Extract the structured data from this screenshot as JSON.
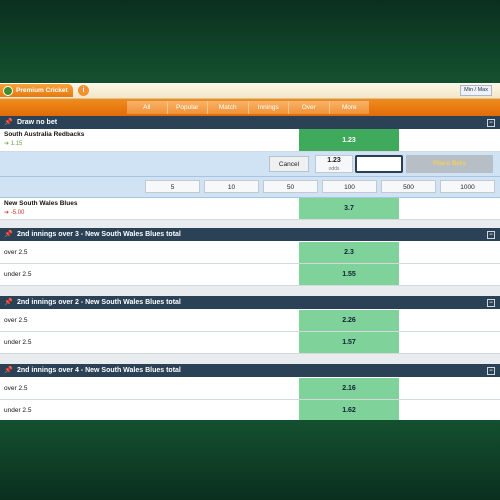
{
  "topbar": {
    "app_title": "Premium Cricket",
    "info_label": "i",
    "minmax_label": "Min / Max"
  },
  "filters": [
    "All",
    "Popular",
    "Match",
    "Innings",
    "Over",
    "More"
  ],
  "draw_no_bet": {
    "title": "Draw no bet",
    "selection1": {
      "name": "South Australia Redbacks",
      "change": "1.15",
      "odds": "1.23"
    },
    "betslip": {
      "cancel_label": "Cancel",
      "odds_value": "1.23",
      "odds_caption": "odds",
      "stake_value": "",
      "place_bet_label": "Place Bets",
      "quick_stakes": [
        "5",
        "10",
        "50",
        "100",
        "500",
        "1000"
      ]
    },
    "selection2": {
      "name": "New South Wales Blues",
      "change": "-5.00",
      "odds": "3.7"
    }
  },
  "markets": [
    {
      "title": "2nd innings over 3 - New South Wales Blues total",
      "rows": [
        {
          "label": "over 2.5",
          "odds": "2.3"
        },
        {
          "label": "under 2.5",
          "odds": "1.55"
        }
      ]
    },
    {
      "title": "2nd innings over 2 - New South Wales Blues total",
      "rows": [
        {
          "label": "over 2.5",
          "odds": "2.26"
        },
        {
          "label": "under 2.5",
          "odds": "1.57"
        }
      ]
    },
    {
      "title": "2nd innings over 4 - New South Wales Blues total",
      "rows": [
        {
          "label": "over 2.5",
          "odds": "2.16"
        },
        {
          "label": "under 2.5",
          "odds": "1.62"
        }
      ]
    }
  ],
  "colors": {
    "accent": "#e57a10",
    "header": "#2a4156",
    "odds": "#7fd39a",
    "selected": "#3faa5c",
    "up": "#6aa84f",
    "down": "#c0392b"
  }
}
